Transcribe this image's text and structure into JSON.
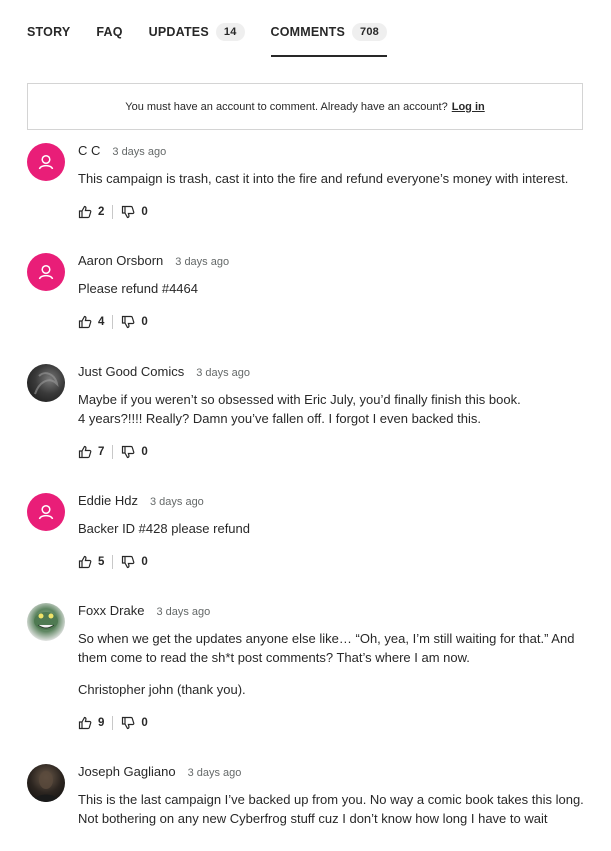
{
  "tabs": [
    {
      "label": "STORY"
    },
    {
      "label": "FAQ"
    },
    {
      "label": "UPDATES",
      "count": "14"
    },
    {
      "label": "COMMENTS",
      "count": "708"
    }
  ],
  "notice": {
    "text": "You must have an account to comment. Already have an account?",
    "login": "Log in"
  },
  "colors": {
    "accent": "#e91e78",
    "text": "#282828",
    "muted": "#656969"
  },
  "comments": [
    {
      "author": "C C",
      "time": "3 days ago",
      "lines": [
        "This campaign is trash, cast it into the fire and refund everyone’s money with interest."
      ],
      "likes": "2",
      "dislikes": "0",
      "avatar": "user-icon"
    },
    {
      "author": "Aaron Orsborn",
      "time": "3 days ago",
      "lines": [
        "Please refund #4464"
      ],
      "likes": "4",
      "dislikes": "0",
      "avatar": "user-icon"
    },
    {
      "author": "Just Good Comics",
      "time": "3 days ago",
      "lines": [
        "Maybe if you weren’t so obsessed with Eric July, you’d finally finish this book.",
        "4 years?!!!! Really? Damn you’ve fallen off. I forgot I even backed this."
      ],
      "likes": "7",
      "dislikes": "0",
      "avatar": "photo"
    },
    {
      "author": "Eddie Hdz",
      "time": "3 days ago",
      "lines": [
        "Backer ID #428 please refund"
      ],
      "likes": "5",
      "dislikes": "0",
      "avatar": "user-icon"
    },
    {
      "author": "Foxx Drake",
      "time": "3 days ago",
      "lines": [
        "So when we get the updates anyone else like… “Oh, yea, I’m still waiting for that.” And them come to read the sh*t post comments? That’s where I am now.",
        "Christopher john (thank you)."
      ],
      "likes": "9",
      "dislikes": "0",
      "avatar": "photo"
    },
    {
      "author": "Joseph Gagliano",
      "time": "3 days ago",
      "lines": [
        "This is the last campaign I’ve backed up from you. No way a comic book takes this long.",
        "Not bothering on any new Cyberfrog stuff cuz I don’t know how long I have to wait"
      ],
      "avatar": "photo"
    }
  ]
}
